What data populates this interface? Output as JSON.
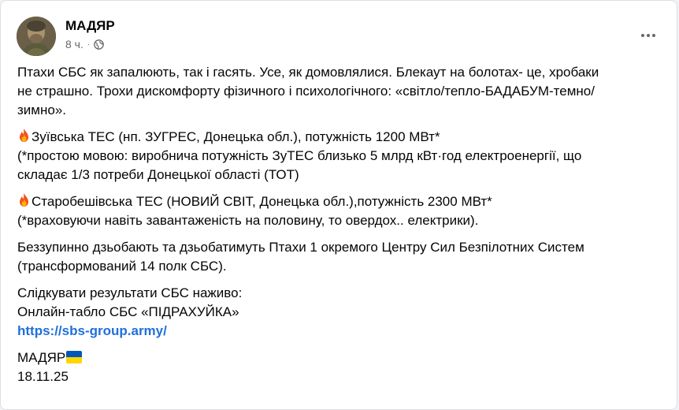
{
  "post": {
    "author": "МАДЯР",
    "time": "8 ч.",
    "separator": "·",
    "paragraphs": {
      "intro": [
        "Птахи СБС як запалюють, так і гасять.  Усе, як домовлялися. Блекаут на болотах- це, хробаки",
        "не страшно. Трохи дискомфорту фізичного і психологічного: «світло/тепло-БАДАБУМ-темно/",
        "зимно»."
      ],
      "zuivska": [
        "Зуївська ТЕС (нп. ЗУГРЕС, Донецька обл.), потужність 1200 МВт*",
        "(*простою мовою: виробнича потужність ЗуТЕС близько 5 млрд кВт·год електроенергії, що",
        "складає 1/3 потреби Донецької області (ТОТ)"
      ],
      "starobeshivska": [
        "Старобешівська ТЕС (НОВИЙ СВІТ, Донецька обл.),потужність 2300 МВт*",
        "(*враховуючи навіть завантаженість на половину, то овердох.. електрики)."
      ],
      "units": [
        "Беззупинно дзьобають  та дзьобатимуть  Птахи 1 окремого Центру Сил Безпілотних Систем",
        "(трансформований 14 полк СБС)."
      ],
      "follow": [
        "Слідкувати результати СБС наживо:",
        "Онлайн-табло СБС «ПІДРАХУЙКА»"
      ]
    },
    "link": "https://sbs-group.army/",
    "signature": "МАДЯР",
    "date": "18.11.25",
    "icons": {
      "fire": "fire-emoji-icon",
      "flag": "ukraine-flag-icon",
      "privacy": "globe-icon",
      "menu": "more-options-icon"
    },
    "colors": {
      "link": "#216fdb",
      "text": "#050505",
      "meta": "#65676b"
    }
  }
}
